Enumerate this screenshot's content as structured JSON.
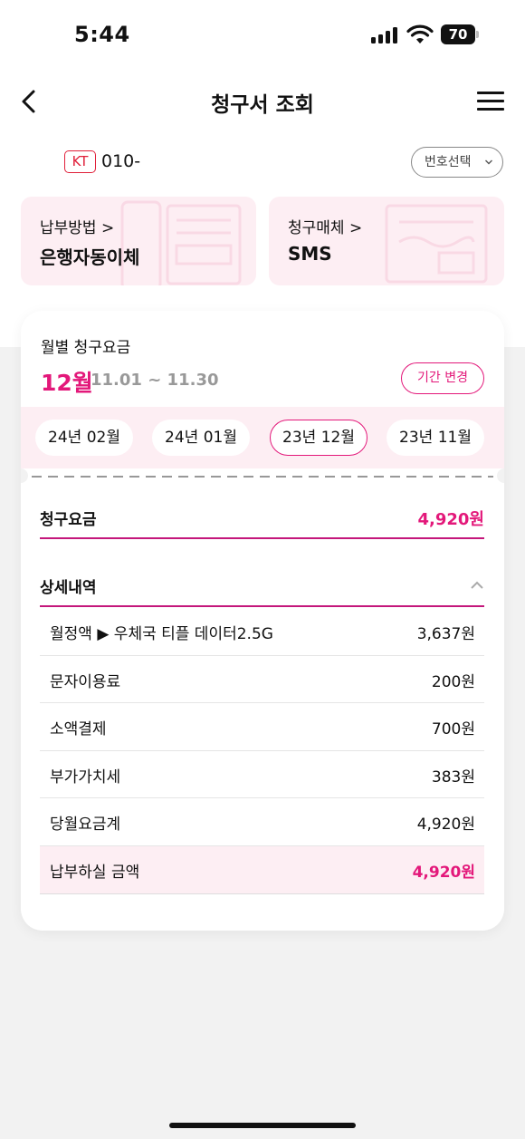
{
  "status_bar": {
    "time": "5:44",
    "battery": "70"
  },
  "header": {
    "title": "청구서 조회"
  },
  "phone": {
    "carrier": "KT",
    "number": "010-",
    "select_label": "번호선택"
  },
  "cards": {
    "payment": {
      "label": "납부방법 >",
      "value": "은행자동이체"
    },
    "media": {
      "label": "청구매체 >",
      "value": "SMS"
    }
  },
  "bill": {
    "monthly_label": "월별 청구요금",
    "month": "12월",
    "range": "11.01 ~ 11.30",
    "period_button": "기간 변경",
    "months": [
      "24년 02월",
      "24년 01월",
      "23년 12월",
      "23년 11월"
    ],
    "selected_month": "23년 12월",
    "total_label": "청구요금",
    "total_value": "4,920원",
    "detail_title": "상세내역",
    "details": [
      {
        "name": "월정액 ▶ 우체국 티플 데이터2.5G",
        "amount": "3,637원"
      },
      {
        "name": "문자이용료",
        "amount": "200원"
      },
      {
        "name": "소액결제",
        "amount": "700원"
      },
      {
        "name": "부가가치세",
        "amount": "383원"
      },
      {
        "name": "당월요금계",
        "amount": "4,920원"
      },
      {
        "name": "납부하실 금액",
        "amount": "4,920원"
      }
    ]
  },
  "colors": {
    "accent": "#e3187a",
    "card_bg": "#fdeef3",
    "carrier_red": "#e0203a"
  },
  "icons": [
    "signal-icon",
    "wifi-icon",
    "battery-icon",
    "back-arrow-icon",
    "hamburger-menu-icon",
    "chevron-down-icon",
    "chevron-up-icon"
  ]
}
